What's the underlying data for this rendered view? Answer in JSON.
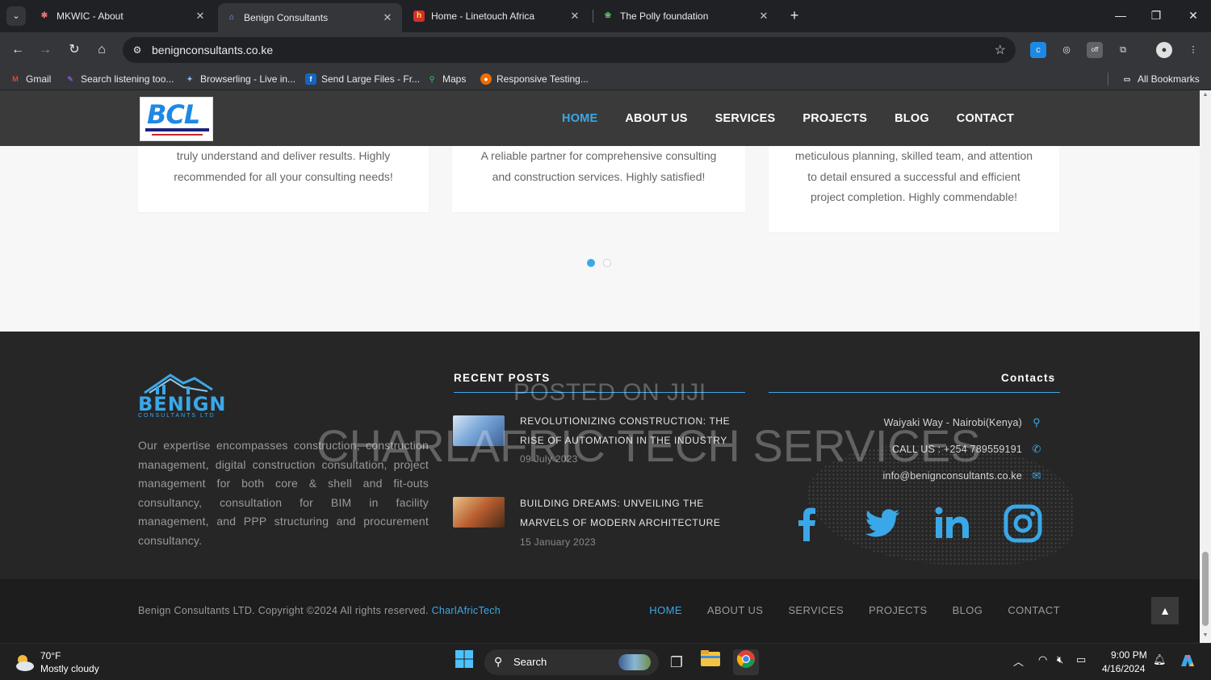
{
  "browser": {
    "tabs": [
      {
        "title": "MKWIC - About",
        "active": false
      },
      {
        "title": "Benign Consultants",
        "active": true
      },
      {
        "title": "Home - Linetouch Africa",
        "active": false
      },
      {
        "title": "The Polly foundation",
        "active": false
      }
    ],
    "url": "benignconsultants.co.ke",
    "bookmarks": [
      {
        "label": "Gmail",
        "icon": "gmail-icon"
      },
      {
        "label": "Search listening too...",
        "icon": "search-listening-icon"
      },
      {
        "label": "Browserling - Live in...",
        "icon": "browserling-icon"
      },
      {
        "label": "Send Large Files - Fr...",
        "icon": "send-files-icon"
      },
      {
        "label": "Maps",
        "icon": "maps-icon"
      },
      {
        "label": "Responsive Testing...",
        "icon": "responsive-icon"
      }
    ],
    "all_bookmarks": "All Bookmarks"
  },
  "site": {
    "logo_text": "BCL",
    "nav": [
      {
        "label": "HOME",
        "active": true
      },
      {
        "label": "ABOUT US",
        "active": false
      },
      {
        "label": "SERVICES",
        "active": false
      },
      {
        "label": "PROJECTS",
        "active": false
      },
      {
        "label": "BLOG",
        "active": false
      },
      {
        "label": "CONTACT",
        "active": false
      }
    ],
    "testimonials": [
      {
        "text": "truly understand and deliver results. Highly recommended for all your consulting needs!"
      },
      {
        "text": "A reliable partner for comprehensive consulting and construction services. Highly satisfied!"
      },
      {
        "text": "meticulous planning, skilled team, and attention to detail ensured a successful and efficient project completion. Highly commendable!"
      }
    ],
    "footer": {
      "logo_name": "BENIGN",
      "logo_sub": "CONSULTANTS LTD",
      "about": "Our expertise encompasses construction, construction management, digital construction consultation, project management for both core & shell and fit-outs consultancy, consultation for BIM in facility management, and PPP structuring and procurement consultancy.",
      "recent_posts_heading": "RECENT POSTS",
      "posts": [
        {
          "title": "REVOLUTIONIZING CONSTRUCTION: THE RISE OF AUTOMATION IN THE INDUSTRY",
          "date": "09 July 2023"
        },
        {
          "title": "BUILDING DREAMS: UNVEILING THE MARVELS OF MODERN ARCHITECTURE",
          "date": "15 January 2023"
        }
      ],
      "contacts_heading": "Contacts",
      "address": "Waiyaki Way - Nairobi(Kenya)",
      "phone": "CALL US : +254 789559191",
      "email": "info@benignconsultants.co.ke",
      "social": [
        "facebook-icon",
        "twitter-icon",
        "linkedin-icon",
        "instagram-icon"
      ]
    },
    "bottom": {
      "copyright": "Benign Consultants LTD. Copyright ©2024 All rights reserved.",
      "credit": "CharlAfricTech",
      "nav": [
        "HOME",
        "ABOUT US",
        "SERVICES",
        "PROJECTS",
        "BLOG",
        "CONTACT"
      ]
    },
    "watermark_top": "POSTED ON JIJI",
    "watermark_main": "CHARLAFRIC TECH SERVICES"
  },
  "taskbar": {
    "temp": "70°F",
    "weather": "Mostly cloudy",
    "search": "Search",
    "time": "9:00 PM",
    "date": "4/16/2024"
  },
  "colors": {
    "accent": "#3aa8e8",
    "header_bg": "#3a3a3a",
    "footer_bg": "#262626",
    "bottom_bg": "#1d1d1d"
  }
}
